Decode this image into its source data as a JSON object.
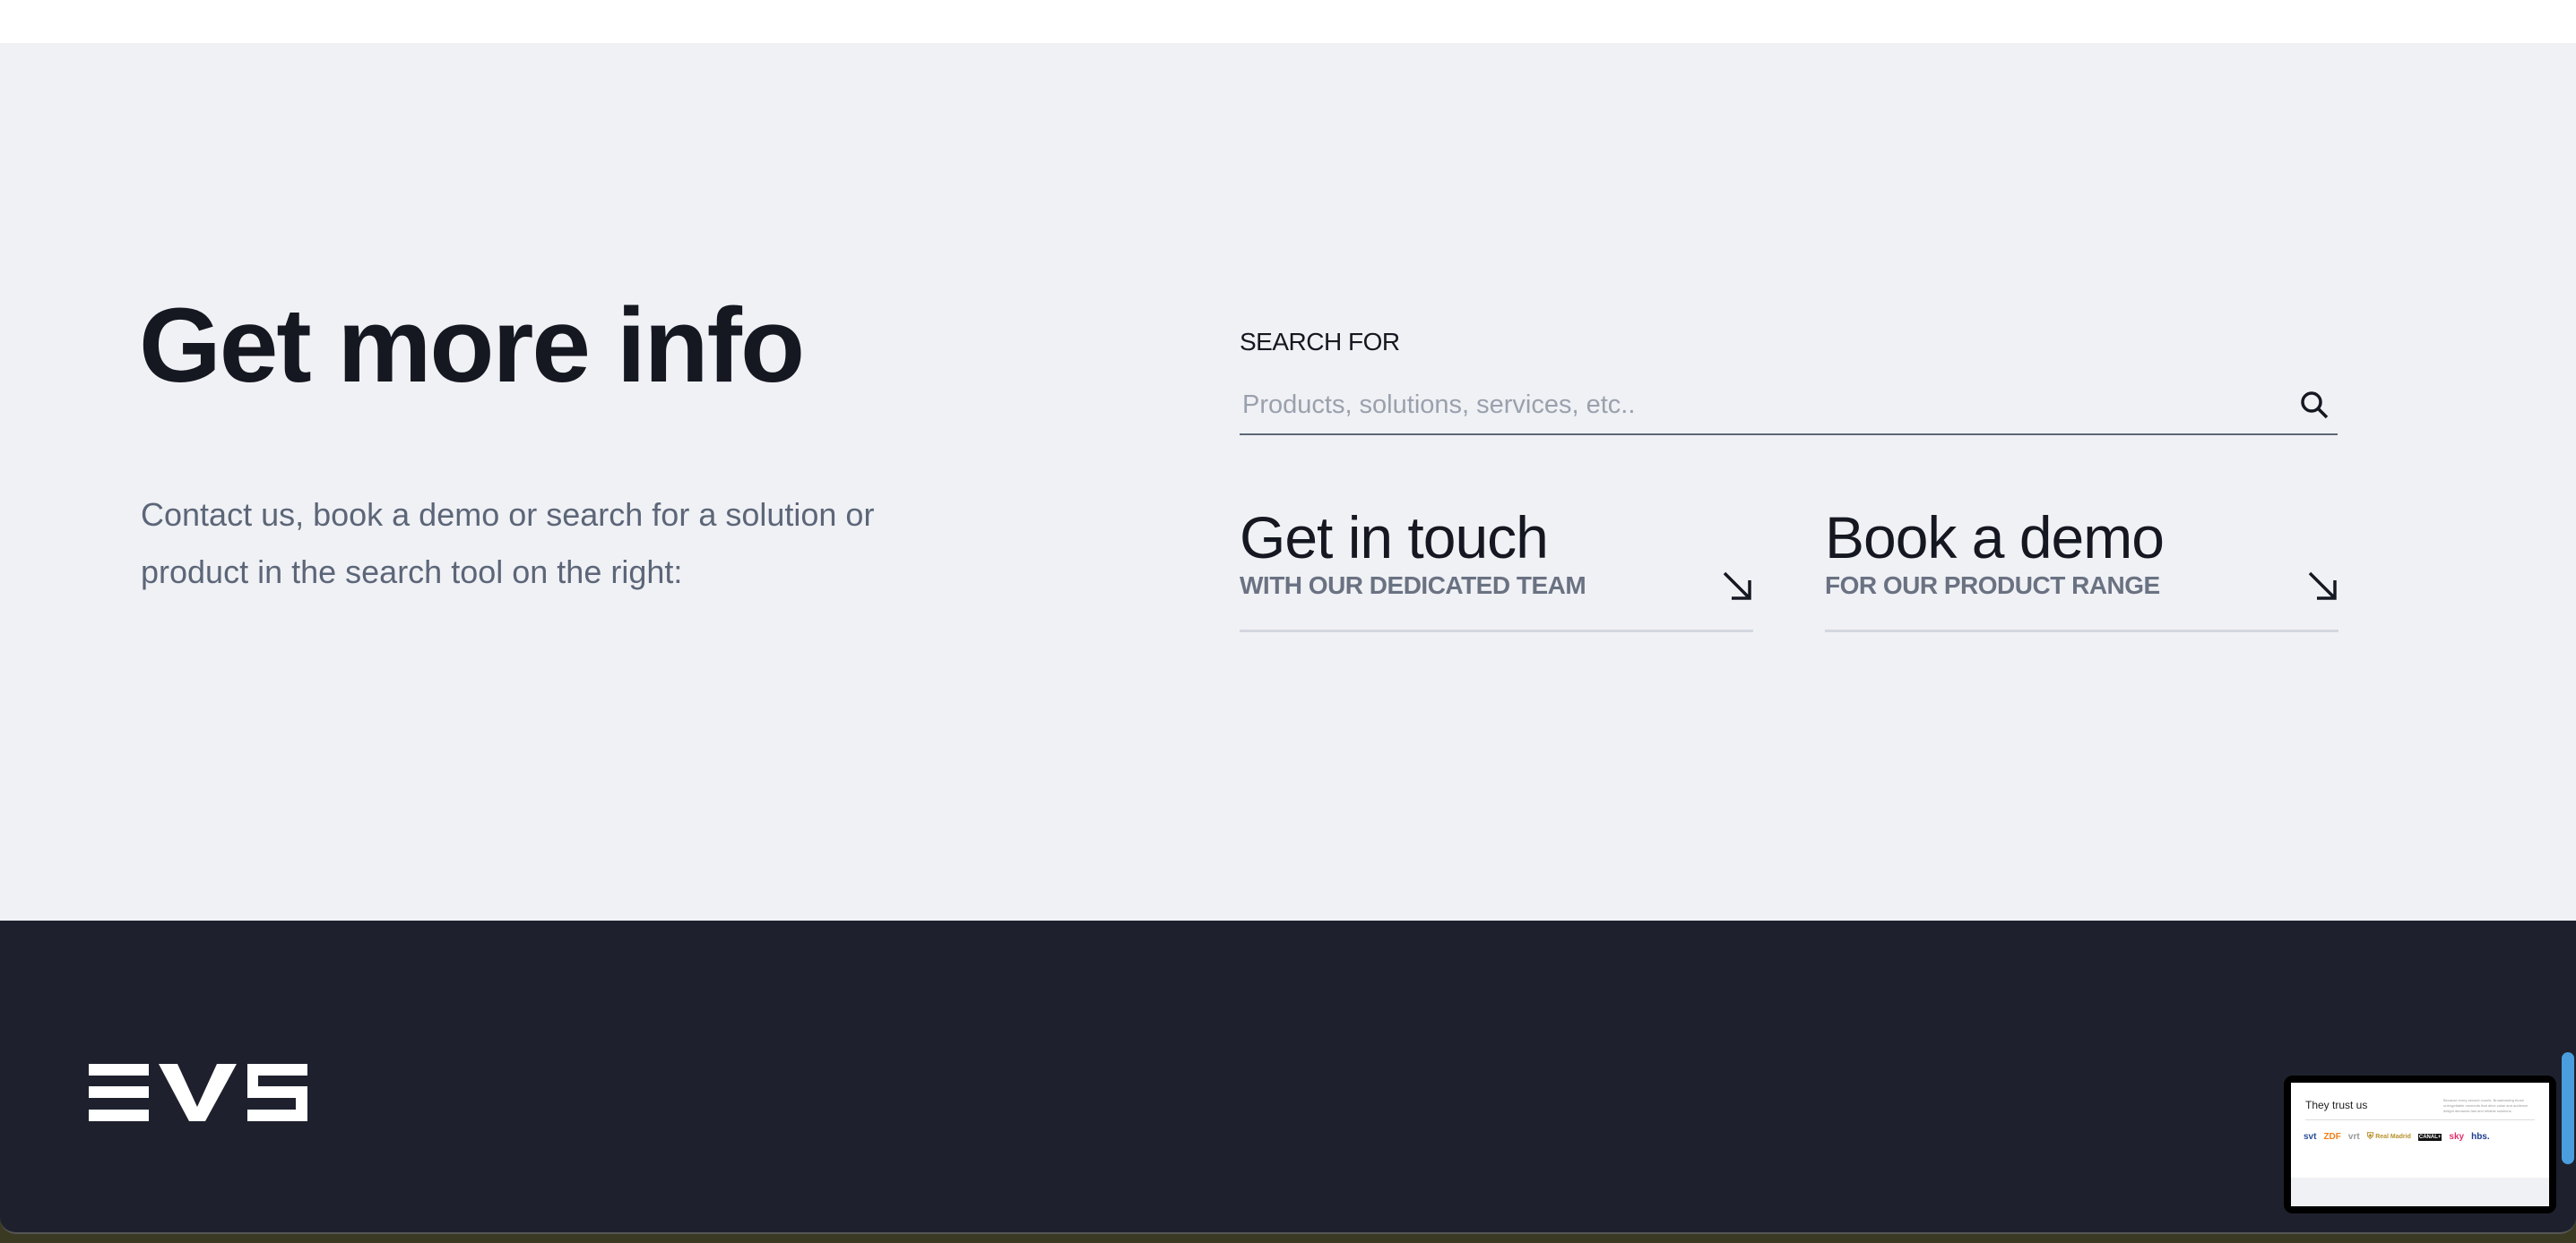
{
  "info": {
    "title": "Get more info",
    "description": "Contact us, book a demo or search for a solution or product in the search tool on the right:"
  },
  "search": {
    "label": "SEARCH FOR",
    "placeholder": "Products, solutions, services, etc..",
    "icon": "search-icon"
  },
  "cards": [
    {
      "title": "Get in touch",
      "subtitle": "WITH OUR DEDICATED TEAM",
      "icon": "arrow-down-right-icon"
    },
    {
      "title": "Book a demo",
      "subtitle": "FOR OUR PRODUCT RANGE",
      "icon": "arrow-down-right-icon"
    }
  ],
  "footer": {
    "logo": "EVS"
  },
  "preview": {
    "title": "They trust us",
    "text": "Because every second counts. Broadcasting those unforgettable moments that drive value and audience delight demands fast and reliable solutions.",
    "logos": [
      "svt",
      "ZDF",
      "vrt",
      "Real Madrid",
      "CANAL+",
      "sky",
      "hbs."
    ]
  },
  "colors": {
    "section_bg": "#f0f1f5",
    "footer_bg": "#1e212d",
    "text": "#151821",
    "muted": "#5c6678",
    "scrollbar": "#4a9ede"
  }
}
